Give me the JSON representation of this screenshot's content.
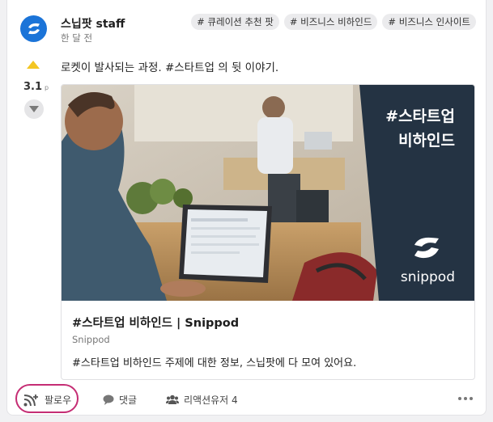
{
  "post": {
    "author": "스닙팟 staff",
    "time": "한 달 전",
    "tags": [
      "# 큐레이션 추천 팟",
      "# 비즈니스 비하인드",
      "# 비즈니스 인사이트"
    ],
    "score": "3.1",
    "score_unit": "p",
    "text": "로켓이 발사되는 과정. #스타트업 의 뒷 이야기."
  },
  "link_card": {
    "overlay_line1": "#스타트업",
    "overlay_line2": "비하인드",
    "brand": "snippod",
    "title": "#스타트업 비하인드 | Snippod",
    "domain": "Snippod",
    "description": "#스타트업 비하인드 주제에 대한 정보, 스닙팟에 다 모여 있어요."
  },
  "footer": {
    "follow_label": "팔로우",
    "comment_label": "댓글",
    "reaction_label": "리액션유저 4"
  },
  "icons": [
    "snippod-logo-icon",
    "upvote-icon",
    "downvote-icon",
    "rss-add-icon",
    "comment-icon",
    "users-icon",
    "more-icon"
  ],
  "colors": {
    "brand_blue": "#1b74d8",
    "upvote": "#f3c623",
    "highlight_ring": "#c52d74",
    "overlay_navy": "#243343"
  }
}
